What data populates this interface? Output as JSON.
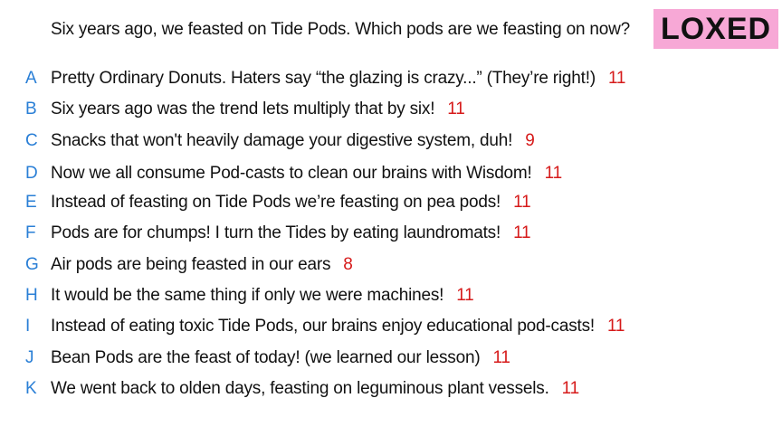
{
  "question": "Six years ago, we feasted on Tide Pods. Which pods are we feasting on now?",
  "badge": "LOXED",
  "colors": {
    "letter": "#2a7fd6",
    "count": "#d61a1a",
    "badge_bg": "#f7a8d6"
  },
  "answers": [
    {
      "letter": "A",
      "text": "Pretty Ordinary Donuts. Haters say “the glazing is crazy...” (They’re right!)",
      "count": "11"
    },
    {
      "letter": "B",
      "text": "Six years ago was the trend lets multiply that by six!",
      "count": "11"
    },
    {
      "letter": "C",
      "text": "Snacks that won't heavily damage your digestive system, duh!",
      "count": "9"
    },
    {
      "letter": "D",
      "text": "Now we all consume Pod-casts to clean our brains with Wisdom!",
      "count": "11"
    },
    {
      "letter": "E",
      "text": "Instead of feasting on Tide Pods we’re feasting on pea pods!",
      "count": "11"
    },
    {
      "letter": "F",
      "text": "Pods are for chumps! I turn the Tides by eating laundromats!",
      "count": "11"
    },
    {
      "letter": "G",
      "text": "Air pods are being feasted in our ears",
      "count": "8"
    },
    {
      "letter": "H",
      "text": "It would be the same thing if only we were machines!",
      "count": "11"
    },
    {
      "letter": "I",
      "text": "Instead of eating toxic Tide Pods, our brains enjoy educational pod-casts!",
      "count": "11"
    },
    {
      "letter": "J",
      "text": "Bean Pods are the feast of today! (we learned our lesson)",
      "count": "11"
    },
    {
      "letter": "K",
      "text": "We went back to olden days, feasting on leguminous plant vessels.",
      "count": "11"
    }
  ]
}
